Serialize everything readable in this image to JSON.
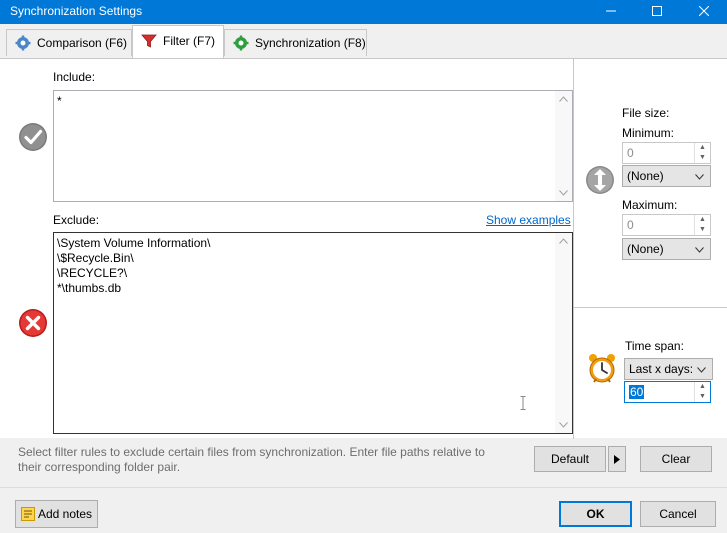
{
  "window": {
    "title": "Synchronization Settings",
    "title_bar_color": "#0078d7"
  },
  "tabs": [
    {
      "label": "Comparison (F6)",
      "icon": "gear-icon",
      "active": false
    },
    {
      "label": "Filter (F7)",
      "icon": "funnel-icon",
      "active": true
    },
    {
      "label": "Synchronization (F8)",
      "icon": "green-gear-icon",
      "active": false
    }
  ],
  "include": {
    "label": "Include:",
    "value": "*",
    "icon": "checkmark-icon"
  },
  "exclude": {
    "label": "Exclude:",
    "show_examples_label": "Show examples",
    "lines": [
      "\\System Volume Information\\",
      "\\$Recycle.Bin\\",
      "\\RECYCLE?\\",
      "*\\thumbs.db"
    ],
    "icon": "red-x-icon"
  },
  "file_size": {
    "label": "File size:",
    "minimum_label": "Minimum:",
    "minimum_value": "0",
    "minimum_unit": "(None)",
    "maximum_label": "Maximum:",
    "maximum_value": "0",
    "maximum_unit": "(None)",
    "icon": "up-down-arrows-icon"
  },
  "time_span": {
    "label": "Time span:",
    "mode": "Last x days:",
    "days": "60",
    "icon": "alarm-clock-icon"
  },
  "hint": "Select filter rules to exclude certain files from synchronization. Enter file paths relative to their corresponding folder pair.",
  "buttons": {
    "default": "Default",
    "clear": "Clear",
    "add_notes": "Add notes",
    "ok": "OK",
    "cancel": "Cancel"
  },
  "colors": {
    "link": "#0066cc",
    "accent": "#0078d7"
  }
}
